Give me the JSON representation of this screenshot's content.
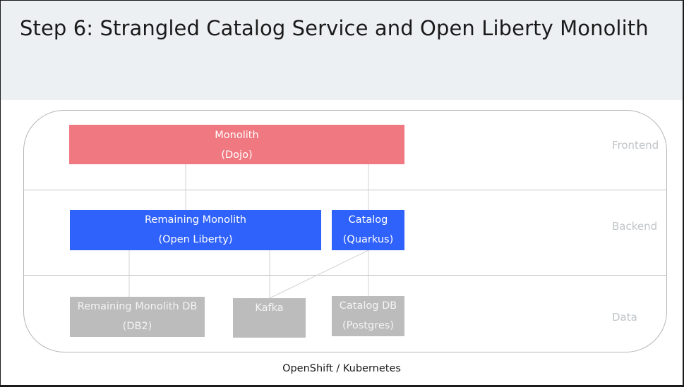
{
  "title": "Step 6: Strangled Catalog Service and Open Liberty Monolith",
  "rows": {
    "frontend": "Frontend",
    "backend": "Backend",
    "data": "Data"
  },
  "nodes": {
    "monolith": {
      "line1": "Monolith",
      "line2": "(Dojo)"
    },
    "remaining_monolith": {
      "line1": "Remaining Monolith",
      "line2": "(Open Liberty)"
    },
    "catalog": {
      "line1": "Catalog",
      "line2": "(Quarkus)"
    },
    "remaining_db": {
      "line1": "Remaining Monolith DB",
      "line2": "(DB2)"
    },
    "kafka": {
      "line1": "Kafka"
    },
    "catalog_db": {
      "line1": "Catalog DB",
      "line2": "(Postgres)"
    }
  },
  "colors": {
    "frontend": "#f07880",
    "backend": "#2f62fa",
    "data": "#bcbcbc"
  },
  "footer": "OpenShift / Kubernetes"
}
